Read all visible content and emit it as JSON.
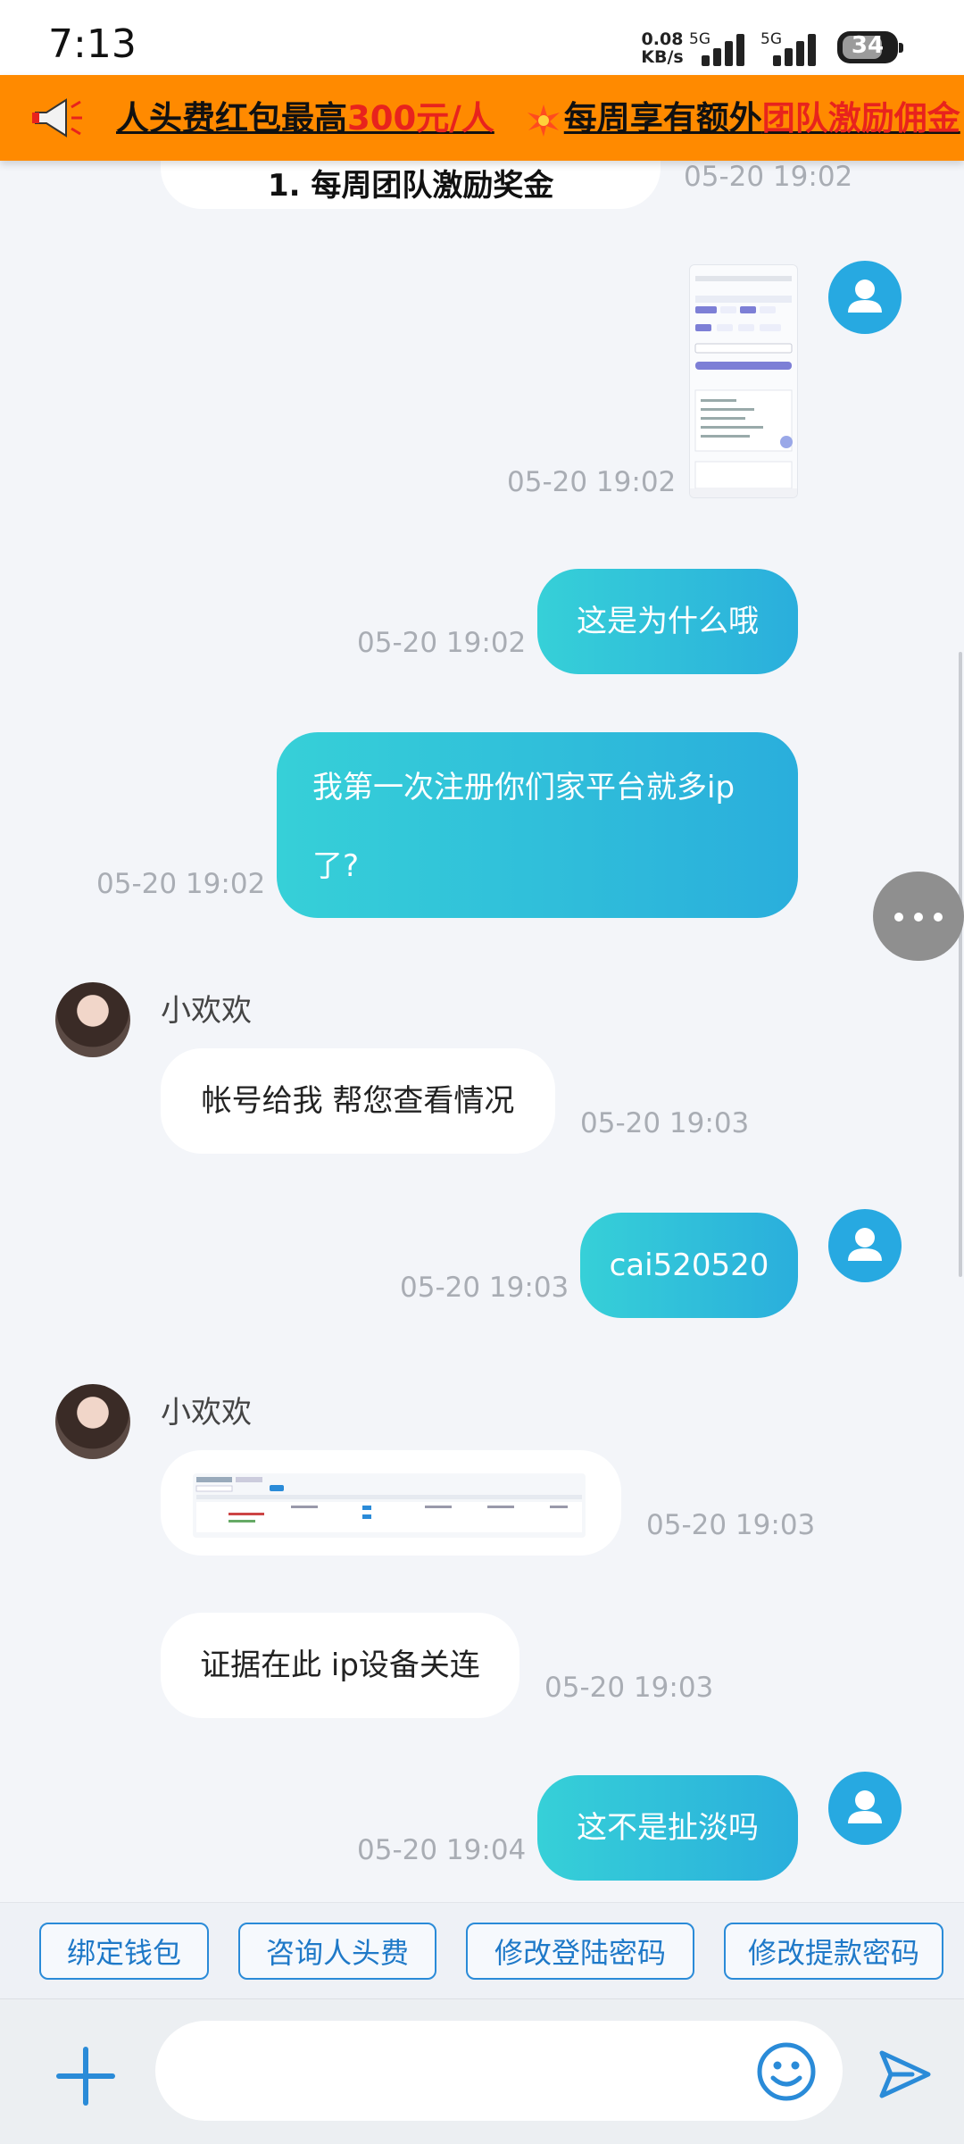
{
  "status_bar": {
    "time": "7:13",
    "net_speed_value": "0.08",
    "net_speed_unit": "KB/s",
    "signal1_label": "5G",
    "signal2_label": "5G",
    "battery": "34"
  },
  "announcement": {
    "part1": "人头费红包最高",
    "part1_highlight": "300元/人",
    "part2": "每周享有额外",
    "part2_highlight": "团队激励佣金"
  },
  "chat": {
    "messages": [
      {
        "text": "1. 每周团队激励奖金",
        "time": "05-20 19:02"
      },
      {
        "time": "05-20 19:02"
      },
      {
        "text": "这是为什么哦",
        "time": "05-20 19:02"
      },
      {
        "text_line1": "我第一次注册你们家平台就多ip",
        "text_line2": "了?",
        "time": "05-20 19:02"
      },
      {
        "sender": "小欢欢",
        "text": "帐号给我 帮您查看情况",
        "time": "05-20 19:03"
      },
      {
        "text": "cai520520",
        "time": "05-20 19:03"
      },
      {
        "sender": "小欢欢",
        "time": "05-20 19:03"
      },
      {
        "text": "证据在此 ip设备关连",
        "time": "05-20 19:03"
      },
      {
        "text": "这不是扯淡吗",
        "time": "05-20 19:04"
      }
    ]
  },
  "quick_actions": [
    "绑定钱包",
    "咨询人头费",
    "修改登陆密码",
    "修改提款密码"
  ],
  "composer": {
    "placeholder": ""
  },
  "colors": {
    "accent": "#2aaedc",
    "outgoing_bubble_start": "#36d0d8",
    "banner": "#ff8a00",
    "banner_highlight": "#e8231d",
    "quick_button": "#1f79c8"
  },
  "icons": [
    "megaphone-icon",
    "sparkle-icon",
    "user-icon",
    "more-icon",
    "plus-icon",
    "emoji-icon",
    "send-icon"
  ]
}
